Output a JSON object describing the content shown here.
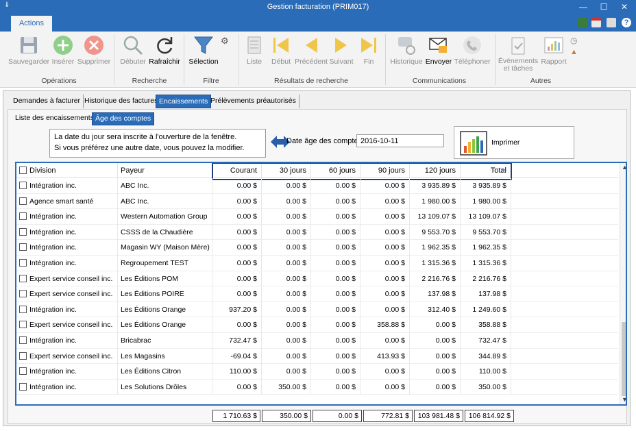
{
  "window": {
    "title": "Gestion facturation (PRIM017)"
  },
  "ribbon_tab": "Actions",
  "ribbon": {
    "buttons": {
      "save": "Sauvegarder",
      "insert": "Insérer",
      "delete": "Supprimer",
      "start": "Débuter",
      "refresh": "Rafraîchir",
      "selection": "Sélection",
      "list": "Liste",
      "first": "Début",
      "prev": "Précédent",
      "next": "Suivant",
      "last": "Fin",
      "history": "Historique",
      "send": "Envoyer",
      "phone": "Téléphoner",
      "events_l1": "Événements",
      "events_l2": "et tâches",
      "report": "Rapport"
    },
    "groups": {
      "operations": "Opérations",
      "search": "Recherche",
      "filter": "Filtre",
      "results": "Résultats de recherche",
      "communications": "Communications",
      "others": "Autres"
    }
  },
  "tabs": [
    "Demandes à facturer",
    "Historique des factures",
    "Encaissements",
    "Prélèvements préautorisés"
  ],
  "subtabs": [
    "Liste des encaissements",
    "Âge des comptes"
  ],
  "note": {
    "line1": "La date du jour sera inscrite à l'ouverture de la fenêtre.",
    "line2": "Si vous préférez une autre date, vous pouvez la modifier."
  },
  "date": {
    "label": "Date âge des comptes",
    "value": "2016-10-11"
  },
  "print_label": "Imprimer",
  "columns": [
    "Division",
    "Payeur",
    "Courant",
    "30 jours",
    "60 jours",
    "90 jours",
    "120 jours",
    "Total"
  ],
  "rows": [
    [
      "Intégration inc.",
      "ABC Inc.",
      "0.00 $",
      "0.00 $",
      "0.00 $",
      "0.00 $",
      "3 935.89 $",
      "3 935.89 $"
    ],
    [
      "Agence smart santé",
      "ABC Inc.",
      "0.00 $",
      "0.00 $",
      "0.00 $",
      "0.00 $",
      "1 980.00 $",
      "1 980.00 $"
    ],
    [
      "Intégration inc.",
      "Western Automation Group",
      "0.00 $",
      "0.00 $",
      "0.00 $",
      "0.00 $",
      "13 109.07 $",
      "13 109.07 $"
    ],
    [
      "Intégration inc.",
      "CSSS de la Chaudière",
      "0.00 $",
      "0.00 $",
      "0.00 $",
      "0.00 $",
      "9 553.70 $",
      "9 553.70 $"
    ],
    [
      "Intégration inc.",
      "Magasin WY (Maison Mère)",
      "0.00 $",
      "0.00 $",
      "0.00 $",
      "0.00 $",
      "1 962.35 $",
      "1 962.35 $"
    ],
    [
      "Intégration inc.",
      "Regroupement TEST",
      "0.00 $",
      "0.00 $",
      "0.00 $",
      "0.00 $",
      "1 315.36 $",
      "1 315.36 $"
    ],
    [
      "Expert service conseil inc.",
      "Les Éditions POM",
      "0.00 $",
      "0.00 $",
      "0.00 $",
      "0.00 $",
      "2 216.76 $",
      "2 216.76 $"
    ],
    [
      "Expert service conseil inc.",
      "Les Éditions POIRE",
      "0.00 $",
      "0.00 $",
      "0.00 $",
      "0.00 $",
      "137.98 $",
      "137.98 $"
    ],
    [
      "Intégration inc.",
      "Les Éditions Orange",
      "937.20 $",
      "0.00 $",
      "0.00 $",
      "0.00 $",
      "312.40 $",
      "1 249.60 $"
    ],
    [
      "Expert service conseil inc.",
      "Les Éditions Orange",
      "0.00 $",
      "0.00 $",
      "0.00 $",
      "358.88 $",
      "0.00 $",
      "358.88 $"
    ],
    [
      "Intégration inc.",
      "Bricabrac",
      "732.47 $",
      "0.00 $",
      "0.00 $",
      "0.00 $",
      "0.00 $",
      "732.47 $"
    ],
    [
      "Expert service conseil inc.",
      "Les Magasins",
      "-69.04 $",
      "0.00 $",
      "0.00 $",
      "413.93 $",
      "0.00 $",
      "344.89 $"
    ],
    [
      "Intégration inc.",
      "Les Éditions Citron",
      "110.00 $",
      "0.00 $",
      "0.00 $",
      "0.00 $",
      "0.00 $",
      "110.00 $"
    ],
    [
      "Intégration inc.",
      "Les Solutions Drôles",
      "0.00 $",
      "350.00 $",
      "0.00 $",
      "0.00 $",
      "0.00 $",
      "350.00 $"
    ]
  ],
  "totals": [
    "1 710.63 $",
    "350.00 $",
    "0.00 $",
    "772.81 $",
    "103 981.48 $",
    "106 814.92 $"
  ]
}
